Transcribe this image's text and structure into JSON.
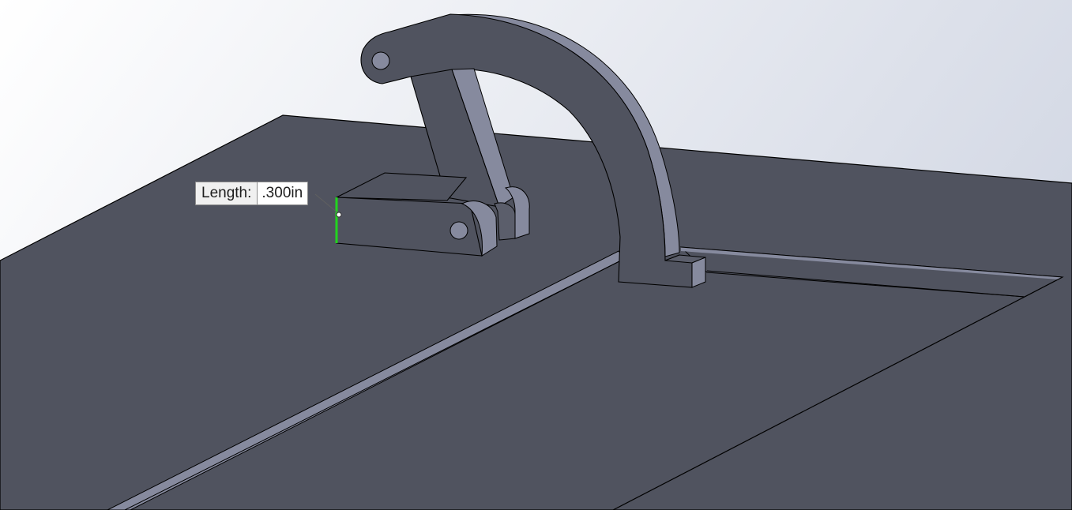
{
  "viewport": {
    "background_top": "#ffffff",
    "background_bottom": "#d6dbe6",
    "model_face_color": "#50535f",
    "model_edge_color": "#000000",
    "model_highlight_color": "#868a9e",
    "selection_color": "#22d41f"
  },
  "measure_tooltip": {
    "label": "Length:",
    "value": ".300in"
  }
}
